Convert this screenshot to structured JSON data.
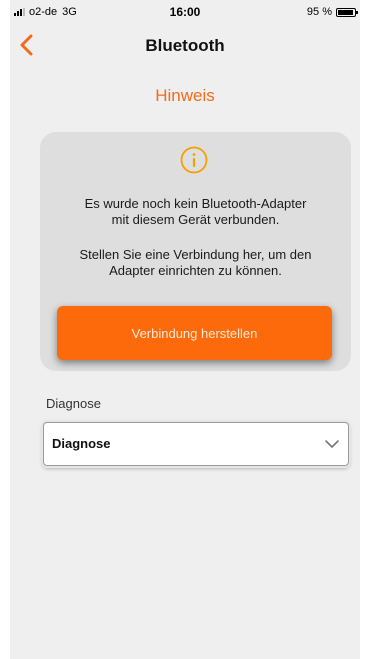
{
  "status_bar": {
    "carrier": "o2-de",
    "network": "3G",
    "time": "16:00",
    "battery_text": "95 %",
    "battery_level": 0.95
  },
  "nav": {
    "title": "Bluetooth",
    "back_icon": "chevron-left-icon"
  },
  "hint": {
    "title": "Hinweis"
  },
  "card": {
    "icon": "info-icon",
    "text1": "Es wurde noch kein Bluetooth-Adapter\nmit diesem Gerät verbunden.",
    "text2": "Stellen Sie eine Verbindung her, um den\nAdapter einrichten zu können.",
    "button_label": "Verbindung herstellen"
  },
  "diagnose": {
    "label": "Diagnose",
    "selected": "Diagnose",
    "chevron_icon": "chevron-down-icon"
  },
  "colors": {
    "accent": "#f36c1c",
    "button": "#fd6a0c",
    "background": "#efefef",
    "card": "#dedede"
  }
}
